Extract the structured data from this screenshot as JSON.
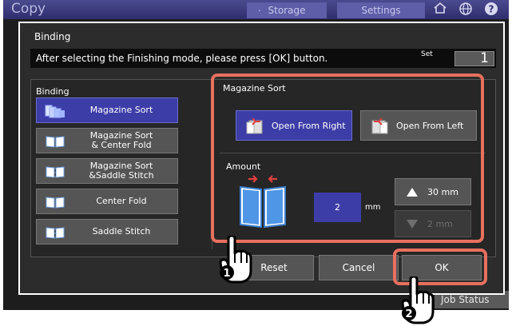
{
  "top": {
    "title": "Copy",
    "storage_label": "Storage",
    "settings_label": "Settings",
    "storage_dot": "."
  },
  "job_status_label": "Job Status",
  "dialog": {
    "title": "Binding",
    "message": "After selecting the Finishing mode, please press [OK] button.",
    "set_label": "Set",
    "set_value": "1"
  },
  "binding": {
    "section_label": "Binding",
    "selected": "Magazine Sort",
    "options": [
      {
        "label": "Magazine Sort",
        "selected": true
      },
      {
        "label": "Magazine Sort\n& Center Fold",
        "selected": false
      },
      {
        "label": "Magazine Sort\n&Saddle Stitch",
        "selected": false
      },
      {
        "label": "Center Fold",
        "selected": false
      },
      {
        "label": "Saddle Stitch",
        "selected": false
      }
    ]
  },
  "magazine_sort": {
    "section_label": "Magazine Sort",
    "open_from_right": "Open From Right",
    "open_from_left": "Open From Left",
    "selected": "Open From Right"
  },
  "amount": {
    "section_label": "Amount",
    "value": "2",
    "unit": "mm",
    "max_label": "30 mm",
    "min_label": "2 mm"
  },
  "footer": {
    "reset_label": "Reset",
    "cancel_label": "Cancel",
    "ok_label": "OK"
  },
  "callouts": {
    "step1": "1",
    "step2": "2"
  },
  "colors": {
    "selected": "#3d3da8",
    "button": "#555555",
    "callout": "#e8705e",
    "background": "#2c2c2c"
  },
  "icons": {
    "storage": "storage-icon",
    "home": "home-icon",
    "globe": "globe-icon",
    "help": "help-icon",
    "finger1": "pointing-hand-icon",
    "finger2": "pointing-hand-icon"
  }
}
